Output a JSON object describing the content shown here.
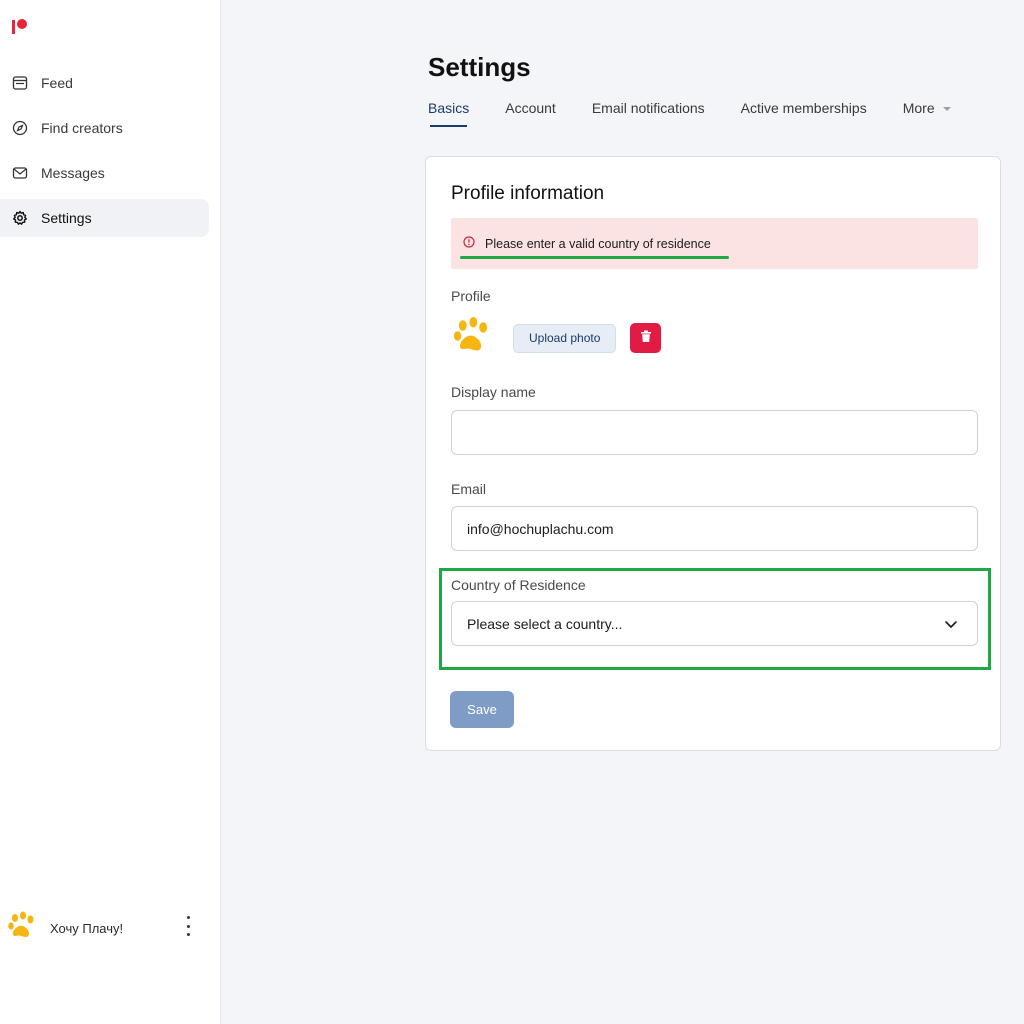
{
  "sidebar": {
    "items": [
      {
        "label": "Feed",
        "icon": "feed-icon"
      },
      {
        "label": "Find creators",
        "icon": "compass-icon"
      },
      {
        "label": "Messages",
        "icon": "envelope-icon"
      },
      {
        "label": "Settings",
        "icon": "gear-icon",
        "active": true
      }
    ],
    "user": {
      "name": "Хочу Плачу!",
      "avatar_icon": "paw-icon"
    }
  },
  "page": {
    "title": "Settings"
  },
  "tabs": [
    {
      "label": "Basics",
      "active": true
    },
    {
      "label": "Account"
    },
    {
      "label": "Email notifications"
    },
    {
      "label": "Active memberships"
    },
    {
      "label": "More"
    }
  ],
  "profile": {
    "title": "Profile information",
    "error": "Please enter a valid country of residence",
    "profile_label": "Profile",
    "upload_label": "Upload photo",
    "display_name_label": "Display name",
    "display_name_value": "",
    "email_label": "Email",
    "email_value": "info@hochuplachu.com",
    "country_label": "Country of Residence",
    "country_value": "Please select a country...",
    "save_label": "Save"
  },
  "colors": {
    "brand": "#e8243c",
    "accent": "#1d3a6b",
    "error_bg": "#fbe3e3",
    "highlight": "#1fa743",
    "save_disabled": "#7f9cc6",
    "delete": "#e21b45"
  }
}
